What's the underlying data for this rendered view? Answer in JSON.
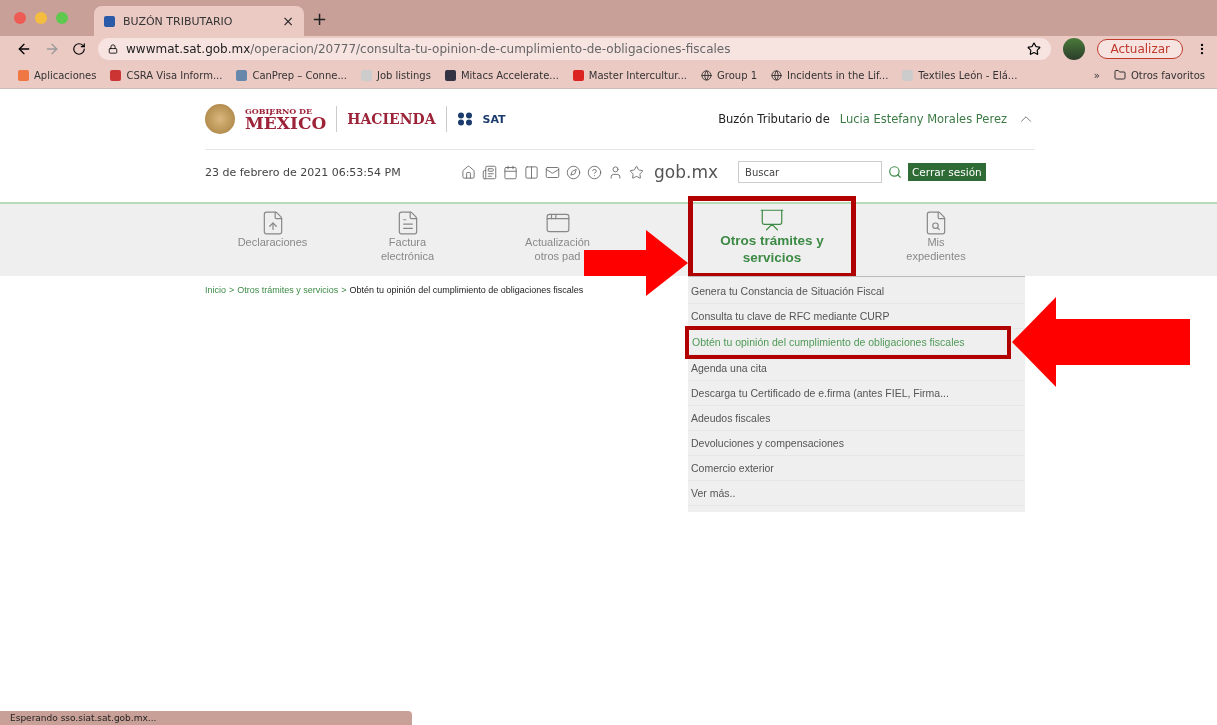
{
  "browser": {
    "tab_title": "BUZÓN TRIBUTARIO",
    "tab_close": "×",
    "new_tab": "+",
    "url_host": "wwwmat.sat.gob.mx",
    "url_path": "/operacion/20777/consulta-tu-opinion-de-cumplimiento-de-obligaciones-fiscales",
    "update_button": "Actualizar",
    "bookmarks": [
      {
        "label": "Aplicaciones",
        "kind": "apps"
      },
      {
        "label": "CSRA Visa Inform...",
        "kind": "flag"
      },
      {
        "label": "CanPrep – Conne...",
        "kind": "mark"
      },
      {
        "label": "Job listings",
        "kind": "doc"
      },
      {
        "label": "Mitacs Accelerate...",
        "kind": "square"
      },
      {
        "label": "Master Intercultur...",
        "kind": "red"
      },
      {
        "label": "Group 1",
        "kind": "globe"
      },
      {
        "label": "Incidents in the Lif...",
        "kind": "globe"
      },
      {
        "label": "Textiles León - Elá...",
        "kind": "doc"
      }
    ],
    "bookmarks_overflow": "»",
    "other_bookmarks": "Otros favoritos"
  },
  "header": {
    "gov_line1": "GOBIERNO DE",
    "gov_line2": "MÉXICO",
    "ministry": "HACIENDA",
    "agency": "SAT",
    "user_prefix": "Buzón Tributario de",
    "user_name": "Lucia Estefany Morales Perez",
    "date": "23 de febrero de 2021 06:53:54 PM",
    "portal": "gob.mx",
    "search_placeholder": "Buscar",
    "logout": "Cerrar sesión"
  },
  "nav": [
    {
      "lines": [
        "Declaraciones"
      ],
      "kind": "upload",
      "selected": false
    },
    {
      "lines": [
        "Factura",
        "electrónica"
      ],
      "kind": "invoice",
      "selected": false
    },
    {
      "lines": [
        "Actualización",
        "otros pad"
      ],
      "kind": "window",
      "selected": false
    },
    {
      "lines": [
        "Otros trámites y",
        "servicios"
      ],
      "kind": "chart",
      "selected": true
    },
    {
      "lines": [
        "Mis",
        "expedientes"
      ],
      "kind": "folder",
      "selected": false
    }
  ],
  "breadcrumb": [
    {
      "text": "Inicio",
      "kind": "link"
    },
    {
      "text": ">",
      "kind": "sep"
    },
    {
      "text": "Otros trámites y servicios",
      "kind": "link"
    },
    {
      "text": ">",
      "kind": "sep"
    },
    {
      "text": "Obtén tu opinión del cumplimiento de obligaciones fiscales",
      "kind": "current"
    }
  ],
  "menu": [
    {
      "label": "Genera tu Constancia de Situación Fiscal",
      "selected": false
    },
    {
      "label": "Consulta tu clave de RFC mediante CURP",
      "selected": false
    },
    {
      "label": "Obtén tu opinión del cumplimiento de obligaciones fiscales",
      "selected": true
    },
    {
      "label": "Agenda una cita",
      "selected": false
    },
    {
      "label": "Descarga tu Certificado de e.firma (antes FIEL, Firma...",
      "selected": false
    },
    {
      "label": "Adeudos fiscales",
      "selected": false
    },
    {
      "label": "Devoluciones y compensaciones",
      "selected": false
    },
    {
      "label": "Comercio exterior",
      "selected": false
    },
    {
      "label": "Ver más..",
      "selected": false
    }
  ],
  "status_bar": "Esperando sso.siat.sat.gob.mx..."
}
